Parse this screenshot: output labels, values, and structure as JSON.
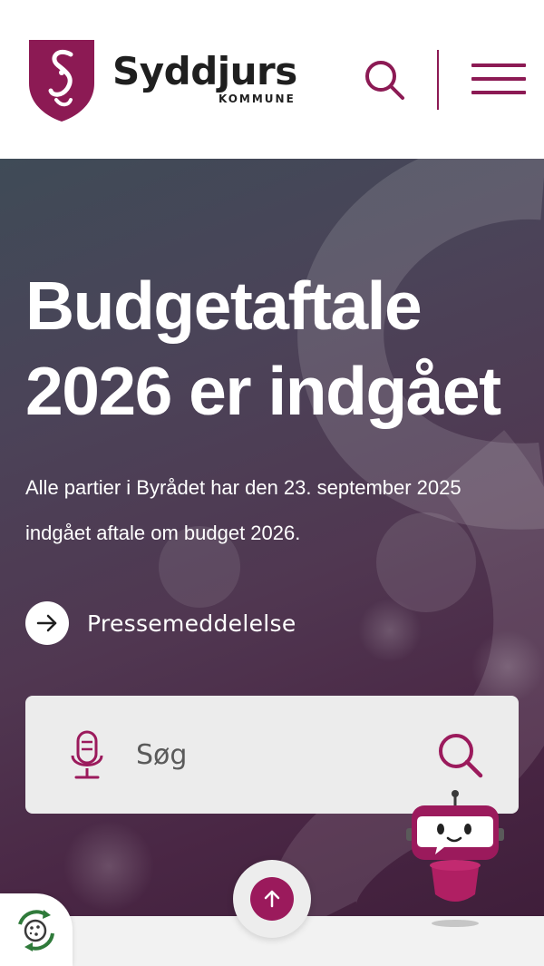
{
  "header": {
    "logo_name": "Syddjurs",
    "logo_subtitle": "KOMMUNE",
    "search_icon": "search-icon",
    "menu_icon": "hamburger-menu-icon"
  },
  "hero": {
    "title_line1": "Budgetaftale",
    "title_line2": "2026 er indgået",
    "description": "Alle partier i Byrådet har den 23. september 2025 indgået aftale om budget 2026.",
    "press_link": "Pressemeddelelse",
    "press_icon": "arrow-right-icon"
  },
  "search": {
    "placeholder": "Søg",
    "mic_icon": "microphone-icon",
    "submit_icon": "search-icon"
  },
  "floating": {
    "scroll_top_icon": "arrow-up-icon",
    "cookie_icon": "cookie-settings-icon",
    "chatbot_icon": "chatbot-robot-icon"
  },
  "colors": {
    "brand": "#8c1a54",
    "accent": "#9b1a5c",
    "hero_dark": "#3f1e3a",
    "searchbox": "#ececec"
  }
}
